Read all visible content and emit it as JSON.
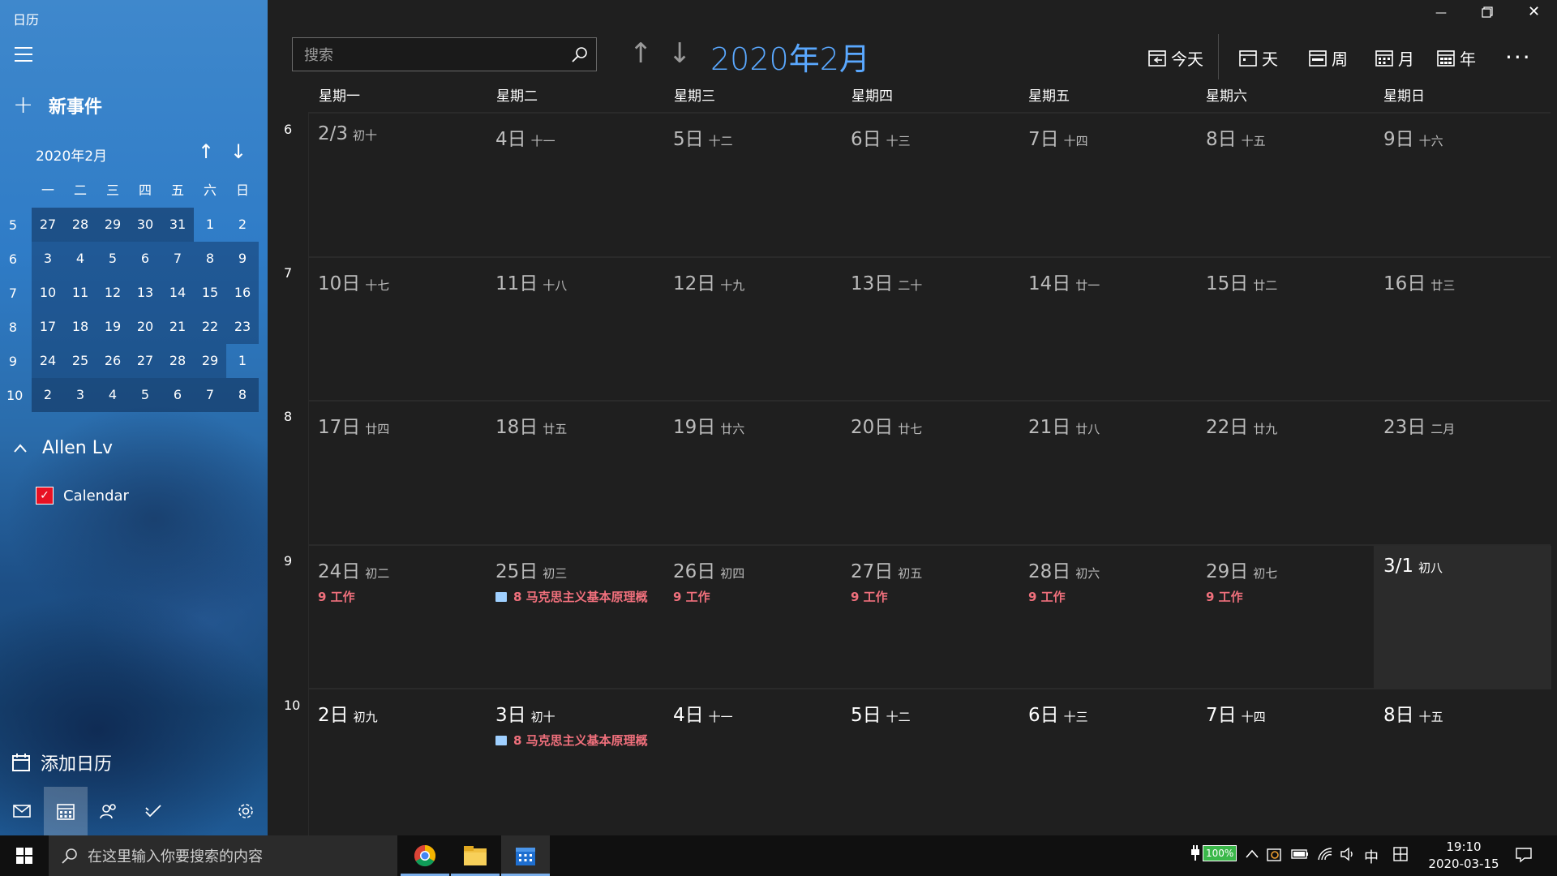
{
  "app": {
    "title": "日历"
  },
  "sidebar": {
    "new_event": "新事件",
    "mini": {
      "title": "2020年2月",
      "dow": [
        "一",
        "二",
        "三",
        "四",
        "五",
        "六",
        "日"
      ],
      "weeks": [
        {
          "wk": "5",
          "days": [
            "27",
            "28",
            "29",
            "30",
            "31",
            "1",
            "2"
          ]
        },
        {
          "wk": "6",
          "days": [
            "3",
            "4",
            "5",
            "6",
            "7",
            "8",
            "9"
          ]
        },
        {
          "wk": "7",
          "days": [
            "10",
            "11",
            "12",
            "13",
            "14",
            "15",
            "16"
          ]
        },
        {
          "wk": "8",
          "days": [
            "17",
            "18",
            "19",
            "20",
            "21",
            "22",
            "23"
          ]
        },
        {
          "wk": "9",
          "days": [
            "24",
            "25",
            "26",
            "27",
            "28",
            "29",
            "1"
          ]
        },
        {
          "wk": "10",
          "days": [
            "2",
            "3",
            "4",
            "5",
            "6",
            "7",
            "8"
          ]
        }
      ]
    },
    "account": "Allen Lv",
    "calendar_name": "Calendar",
    "add_calendar": "添加日历"
  },
  "header": {
    "search_placeholder": "搜索",
    "title": "2020年2月",
    "views": {
      "today": "今天",
      "day": "天",
      "week": "周",
      "month": "月",
      "year": "年"
    },
    "more": "···"
  },
  "weekdays": [
    "星期一",
    "星期二",
    "星期三",
    "星期四",
    "星期五",
    "星期六",
    "星期日"
  ],
  "week_numbers": [
    "6",
    "7",
    "8",
    "9",
    "10"
  ],
  "month_grid": [
    [
      {
        "d": "2/3",
        "l": "初十"
      },
      {
        "d": "4日",
        "l": "十一"
      },
      {
        "d": "5日",
        "l": "十二"
      },
      {
        "d": "6日",
        "l": "十三"
      },
      {
        "d": "7日",
        "l": "十四"
      },
      {
        "d": "8日",
        "l": "十五"
      },
      {
        "d": "9日",
        "l": "十六"
      }
    ],
    [
      {
        "d": "10日",
        "l": "十七"
      },
      {
        "d": "11日",
        "l": "十八"
      },
      {
        "d": "12日",
        "l": "十九"
      },
      {
        "d": "13日",
        "l": "二十"
      },
      {
        "d": "14日",
        "l": "廿一"
      },
      {
        "d": "15日",
        "l": "廿二"
      },
      {
        "d": "16日",
        "l": "廿三"
      }
    ],
    [
      {
        "d": "17日",
        "l": "廿四"
      },
      {
        "d": "18日",
        "l": "廿五"
      },
      {
        "d": "19日",
        "l": "廿六"
      },
      {
        "d": "20日",
        "l": "廿七"
      },
      {
        "d": "21日",
        "l": "廿八"
      },
      {
        "d": "22日",
        "l": "廿九"
      },
      {
        "d": "23日",
        "l": "二月"
      }
    ],
    [
      {
        "d": "24日",
        "l": "初二",
        "e": "9 工作"
      },
      {
        "d": "25日",
        "l": "初三",
        "e": "8 马克思主义基本原理概",
        "book": true
      },
      {
        "d": "26日",
        "l": "初四",
        "e": "9 工作"
      },
      {
        "d": "27日",
        "l": "初五",
        "e": "9 工作"
      },
      {
        "d": "28日",
        "l": "初六",
        "e": "9 工作"
      },
      {
        "d": "29日",
        "l": "初七",
        "e": "9 工作"
      },
      {
        "d": "3/1",
        "l": "初八",
        "hl": true
      }
    ],
    [
      {
        "d": "2日",
        "l": "初九"
      },
      {
        "d": "3日",
        "l": "初十",
        "e": "8 马克思主义基本原理概",
        "book": true
      },
      {
        "d": "4日",
        "l": "十一"
      },
      {
        "d": "5日",
        "l": "十二"
      },
      {
        "d": "6日",
        "l": "十三"
      },
      {
        "d": "7日",
        "l": "十四"
      },
      {
        "d": "8日",
        "l": "十五"
      }
    ]
  ],
  "taskbar": {
    "search_placeholder": "在这里输入你要搜索的内容",
    "battery": "100%",
    "ime_lang": "中",
    "time": "19:10",
    "date": "2020-03-15"
  },
  "colors": {
    "accent": "#5aa8ff",
    "event": "#f0707c",
    "sidebar": "#2f7cc7"
  }
}
